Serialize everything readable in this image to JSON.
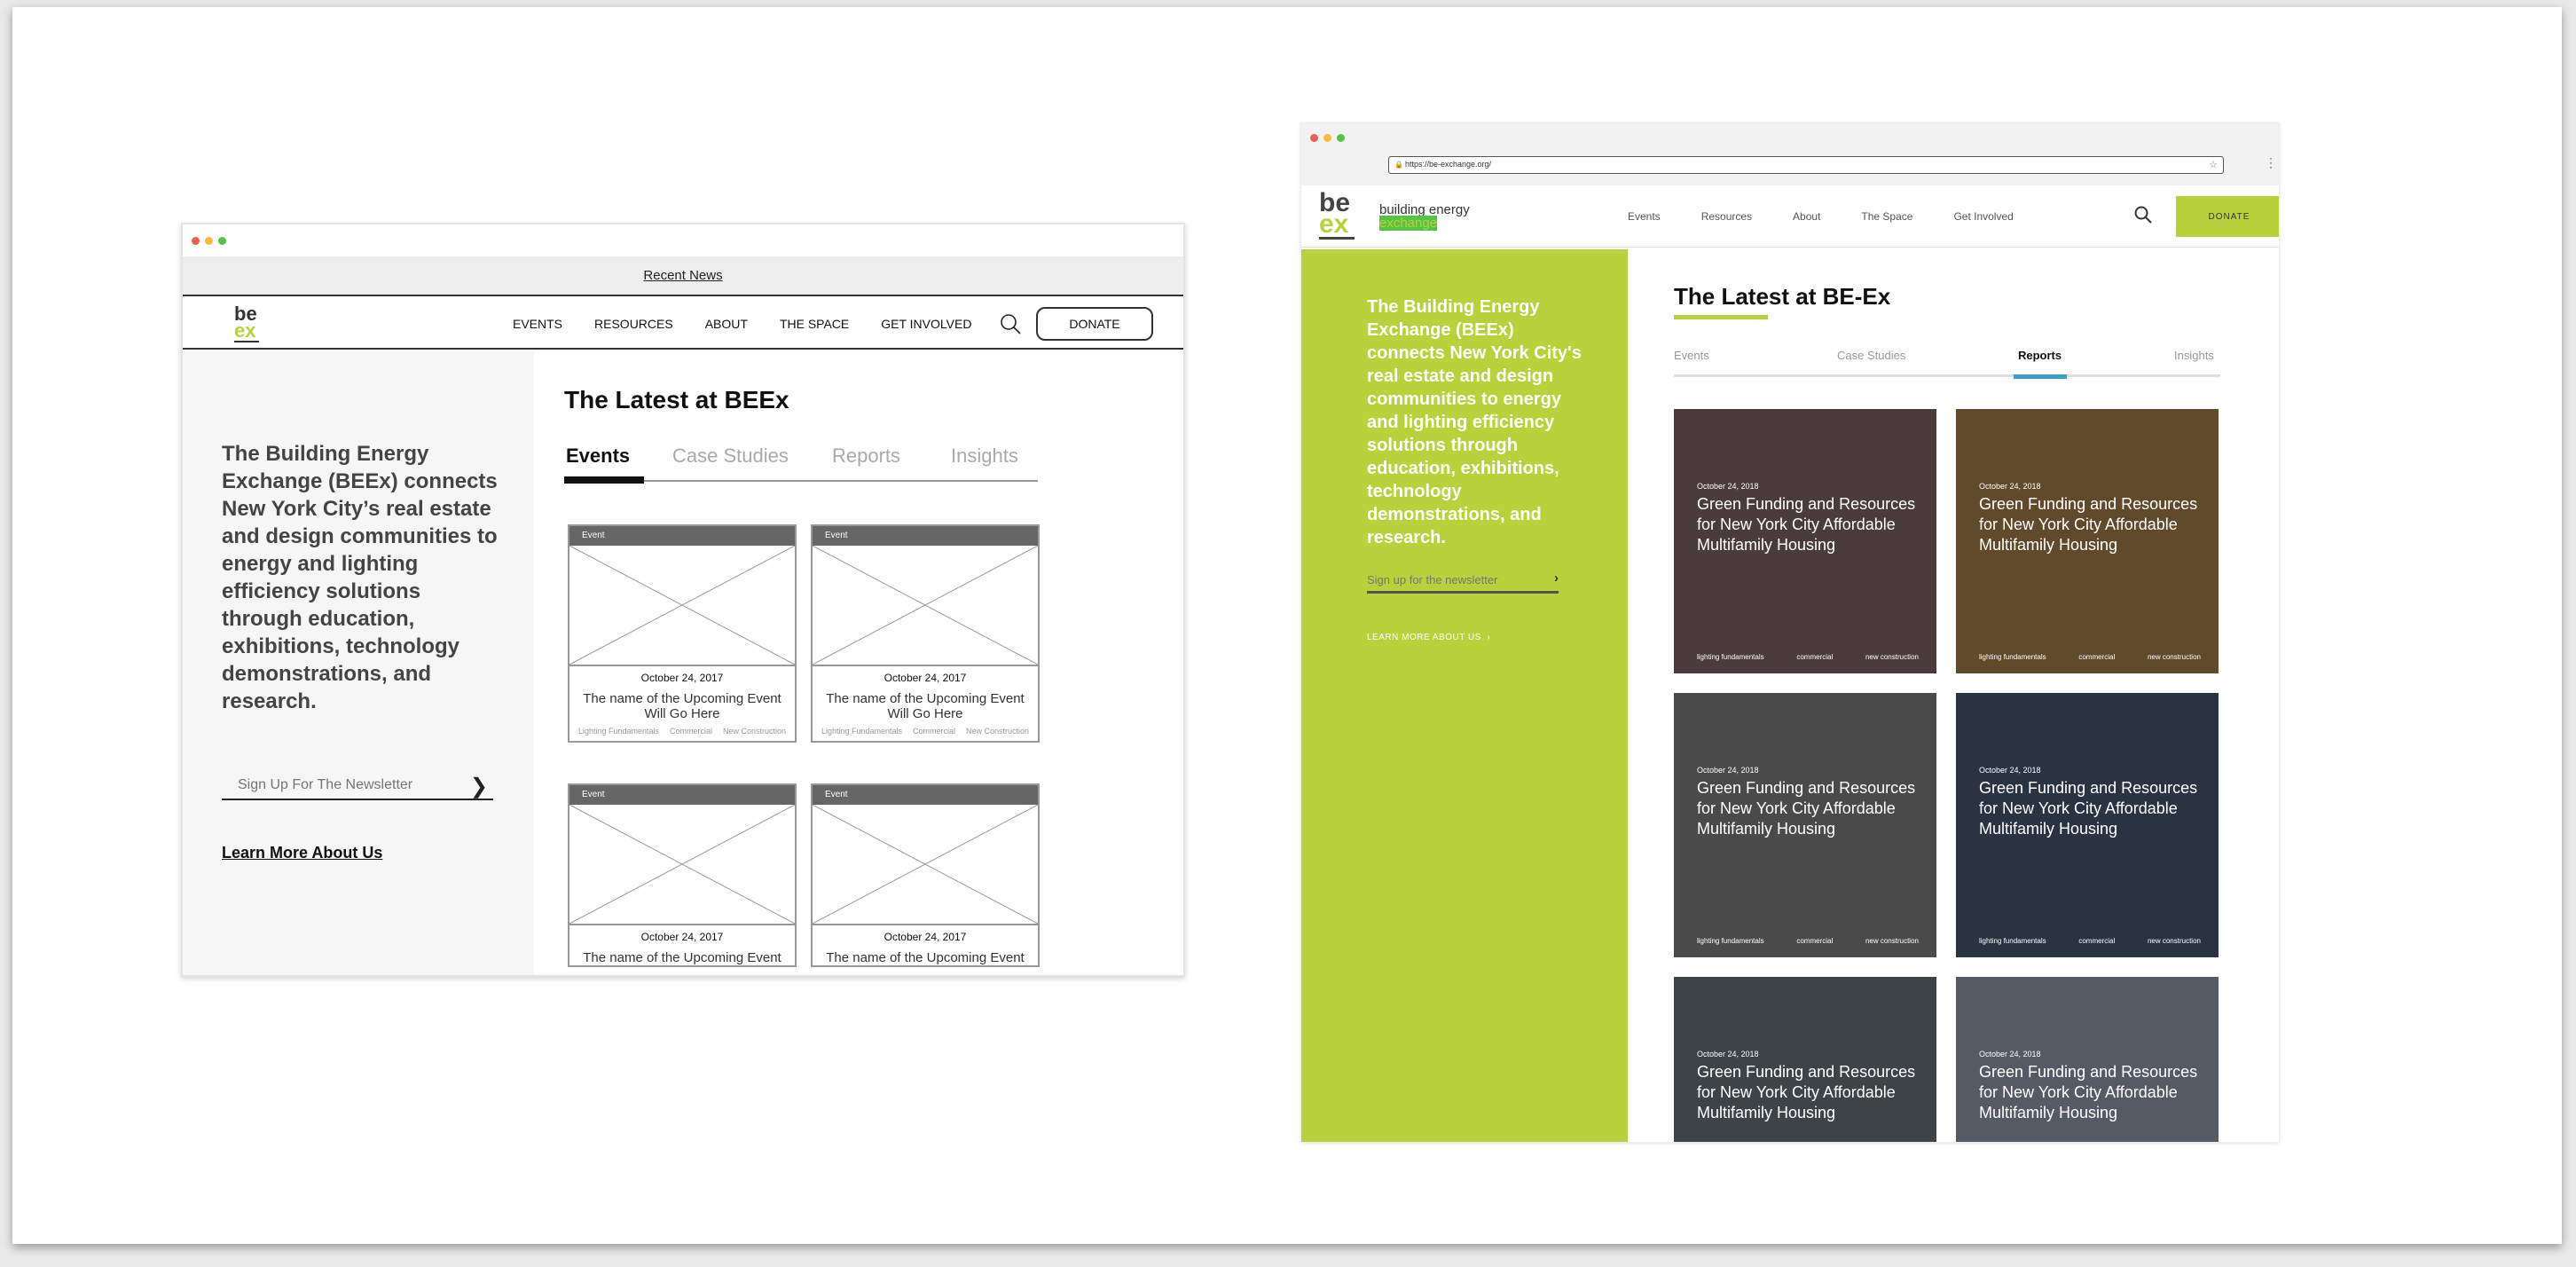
{
  "wireframe": {
    "news_bar": "Recent News",
    "logo_top": "be",
    "logo_bottom": "ex",
    "nav": [
      "EVENTS",
      "RESOURCES",
      "ABOUT",
      "THE SPACE",
      "GET INVOLVED"
    ],
    "donate": "DONATE",
    "intro": "The Building Energy Exchange (BEEx) connects New York City’s real estate and design communities to energy and lighting efficiency solutions through education, exhibitions, technology demonstrations, and research.",
    "newsletter_placeholder": "Sign Up For The Newsletter",
    "learn_more": "Learn More About Us",
    "heading": "The Latest at BEEx",
    "tabs": [
      "Events",
      "Case Studies",
      "Reports",
      "Insights"
    ],
    "cards": [
      {
        "label": "Event",
        "date": "October 24, 2017",
        "name": "The name of the Upcoming Event Will Go Here",
        "tags": [
          "Lighting Fundamentals",
          "Commercial",
          "New Construction"
        ]
      },
      {
        "label": "Event",
        "date": "October 24, 2017",
        "name": "The name of the Upcoming Event Will Go Here",
        "tags": [
          "Lighting Fundamentals",
          "Commercial",
          "New Construction"
        ]
      },
      {
        "label": "Event",
        "date": "October 24, 2017",
        "name": "The name of the Upcoming Event",
        "tags": [
          "",
          "",
          ""
        ]
      },
      {
        "label": "Event",
        "date": "October 24, 2017",
        "name": "The name of the Upcoming Event",
        "tags": [
          "",
          "",
          ""
        ]
      }
    ]
  },
  "final": {
    "url": "https://be-exchange.org/",
    "logo_top": "be",
    "logo_bottom": "ex",
    "brand_line1": "building energy",
    "brand_line2": "exchange",
    "nav": [
      "Events",
      "Resources",
      "About",
      "The Space",
      "Get Involved"
    ],
    "donate": "DONATE",
    "intro": "The Building Energy Exchange (BEEx) connects New York City's real estate and design communities to energy and lighting efficiency solutions through education, exhibitions, technology demonstrations, and research.",
    "newsletter_placeholder": "Sign up for the newsletter",
    "learn_more": "LEARN MORE ABOUT US",
    "heading": "The Latest at BE-Ex",
    "tabs": [
      "Events",
      "Case Studies",
      "Reports",
      "Insights"
    ],
    "cards": [
      {
        "date": "October 24, 2018",
        "title": "Green Funding and Resources for New York City Affordable Multifamily Housing",
        "tags": [
          "lighting fundamentals",
          "commercial",
          "new construction"
        ],
        "bg": "#6b5656"
      },
      {
        "date": "October 24, 2018",
        "title": "Green Funding and Resources for New York City Affordable Multifamily Housing",
        "tags": [
          "lighting fundamentals",
          "commercial",
          "new construction"
        ],
        "bg": "#8a6a3e"
      },
      {
        "date": "October 24, 2018",
        "title": "Green Funding and Resources for New York City Affordable Multifamily Housing",
        "tags": [
          "lighting fundamentals",
          "commercial",
          "new construction"
        ],
        "bg": "#6a6a6a"
      },
      {
        "date": "October 24, 2018",
        "title": "Green Funding and Resources for New York City Affordable Multifamily Housing",
        "tags": [
          "lighting fundamentals",
          "commercial",
          "new construction"
        ],
        "bg": "#3c4a5e"
      },
      {
        "date": "October 24, 2018",
        "title": "Green Funding and Resources for New York City Affordable Multifamily Housing",
        "tags": [
          "",
          "",
          ""
        ],
        "bg": "#5a6068"
      },
      {
        "date": "October 24, 2018",
        "title": "Green Funding and Resources for New York City Affordable Multifamily Housing",
        "tags": [
          "",
          "",
          ""
        ],
        "bg": "#7a8290"
      }
    ]
  },
  "colors": {
    "brand_green": "#b9d13a",
    "tab_indicator": "#3aa0c8"
  }
}
